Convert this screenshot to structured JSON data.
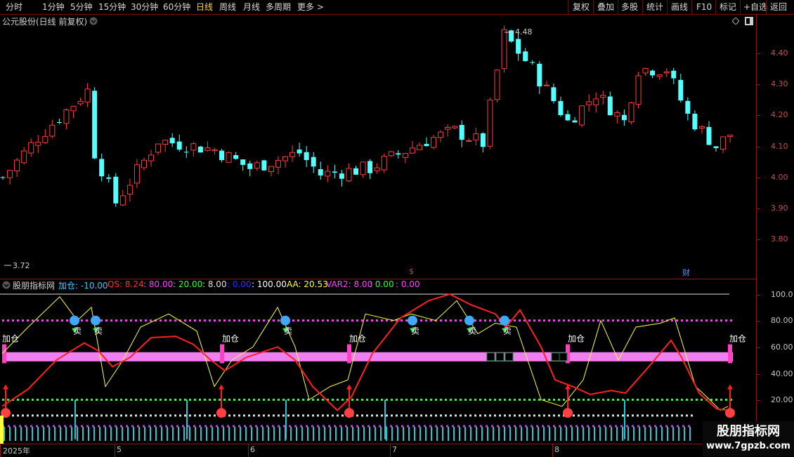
{
  "toolbar": {
    "left_items": [
      "分时",
      "1分钟",
      "5分钟",
      "15分钟",
      "30分钟",
      "60分钟",
      "日线",
      "周线",
      "月线",
      "多周期",
      "更多 >"
    ],
    "active_item": "日线",
    "right_items": [
      "复权",
      "叠加",
      "多股",
      "统计",
      "画线",
      "F10",
      "标记",
      "+自选",
      "返回"
    ]
  },
  "main_chart": {
    "title": "公元股份(日线 前复权)",
    "high_label": "4.48",
    "low_label": "3.72",
    "marker_dollar": "$",
    "marker_cai": "财",
    "y_ticks": [
      "4.40",
      "4.30",
      "4.20",
      "4.10",
      "4.00",
      "3.90",
      "3.80"
    ]
  },
  "indicator": {
    "name": "股朋指标网",
    "values": [
      {
        "text": "加仓: -10.00",
        "color": "#40c8ff"
      },
      {
        "text": "QS: 8.24",
        "color": "#ff3030"
      },
      {
        "text": ": 80.00",
        "color": "#ff40ff"
      },
      {
        "text": ": 20.00",
        "color": "#30ff30"
      },
      {
        "text": ": 8.00",
        "color": "#e0e0e0"
      },
      {
        "text": ": 0.00",
        "color": "#3030ff"
      },
      {
        "text": ": 100.00",
        "color": "#ffffff"
      },
      {
        "text": "AA: 20.53",
        "color": "#ffff40"
      },
      {
        "text": "VAR2: 8.00",
        "color": "#ff40ff"
      },
      {
        "text": ": 0.00",
        "color": "#30ff30"
      },
      {
        "text": ": 0.00",
        "color": "#ff40ff"
      }
    ],
    "y_ticks": [
      "100.0",
      "80.00",
      "60.00",
      "40.00",
      "20.00"
    ],
    "add_label": "加仓",
    "sell_label": "卖"
  },
  "date_axis": [
    "2025年",
    "5",
    "6",
    "7",
    "8"
  ],
  "watermark": {
    "line1": "股朋指标网",
    "line2": "www.7gpzb.com"
  },
  "colors": {
    "up": "#ff3c3c",
    "down": "#54ffff",
    "frame": "#8a1a1a",
    "accent": "#ffd24a"
  },
  "icons": {
    "settings": "gear-icon",
    "expand": "chevron-down-icon",
    "diamond": "diamond-icon",
    "restore": "window-icon"
  }
}
